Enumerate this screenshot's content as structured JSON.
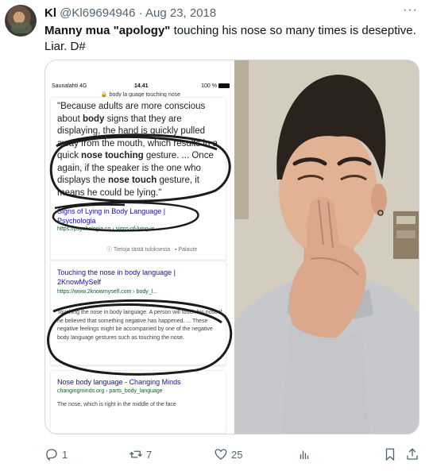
{
  "author": {
    "display_name": "Kl",
    "handle": "@Kl69694946",
    "separator": "·",
    "date": "Aug 23, 2018"
  },
  "more_icon": "more-horizontal-icon",
  "tweet": {
    "text_bold": "Manny mua \"apology\"",
    "text_rest": " touching his nose so many times is deseptive. Liar. D#"
  },
  "screenshot": {
    "status": {
      "carrier": "Saunalahti 4G",
      "time": "14.41",
      "battery": "100 %"
    },
    "url": "body la guage touching nose",
    "result1": {
      "snippet_parts": [
        "\"Because adults are more conscious about ",
        "body",
        " signs that they are displaying, the hand is quickly pulled away from the mouth, which results in a quick ",
        "nose touching",
        " gesture. ... Once again, if the speaker is the one who displays the ",
        "nose touch",
        " gesture, it means he could be lying.\""
      ],
      "link": "Signs of Lying in Body Language | Psychologia",
      "url": "https://psychologia.co › signs-of-lying-in...",
      "about": "Tietoja tästä tuloksesta",
      "feedback": "Palaute"
    },
    "result2": {
      "link": "Touching the nose in body language | 2KnowMySelf",
      "url": "https://www.2knowmyself.com › body_l...",
      "snippet": "Touching the nose in body language. A person will touch his nose if he believed that something negative has happened. ... These negative feelings might be accompanied by one of the negative body language gestures such as touching the nose."
    },
    "result3": {
      "link": "Nose body language - Changing Minds",
      "url": "changingminds.org › parts_body_language",
      "snippet": "The nose, which is right in the middle of the face"
    }
  },
  "actions": {
    "replies": "1",
    "retweets": "7",
    "likes": "25"
  },
  "colors": {
    "link_blue": "#1a0dab",
    "url_green": "#006621",
    "scribble": "#1b1b1b",
    "muted": "#536471"
  }
}
